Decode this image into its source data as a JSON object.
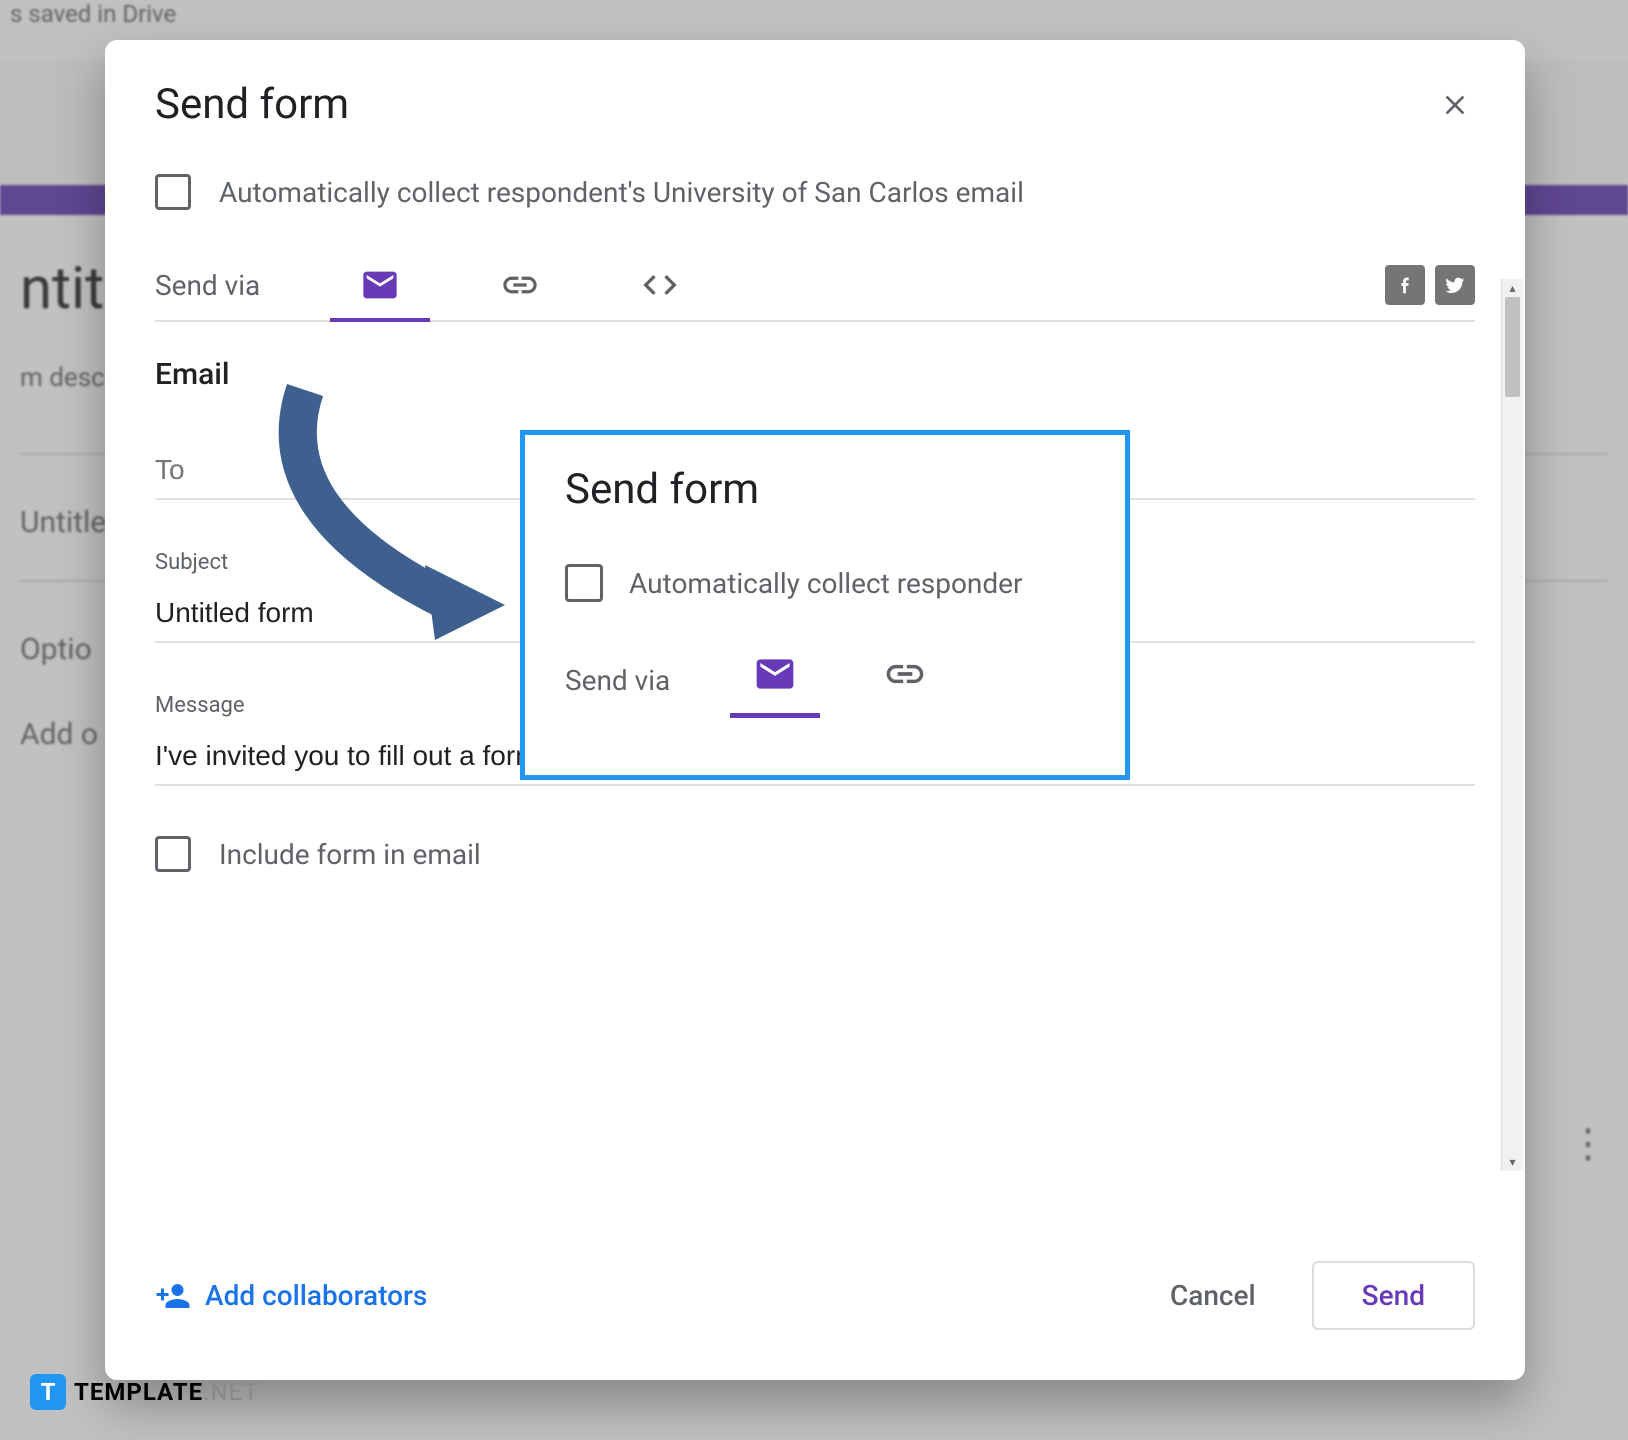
{
  "background": {
    "saved_text": "s saved in Drive",
    "form_title_partial": "ntit",
    "form_desc_partial": "m desc",
    "untitled_partial": "Untitle",
    "option_partial": "Optio",
    "add_partial": "Add o"
  },
  "dialog": {
    "title": "Send form",
    "auto_collect_label": "Automatically collect respondent's University of San Carlos email",
    "send_via_label": "Send via",
    "email_section": "Email",
    "to_label": "To",
    "to_value": "",
    "subject_label": "Subject",
    "subject_value": "Untitled form",
    "message_label": "Message",
    "message_value": "I've invited you to fill out a form:",
    "include_form_label": "Include form in email",
    "add_collaborators_label": "Add collaborators",
    "cancel_label": "Cancel",
    "send_label": "Send"
  },
  "callout": {
    "title": "Send form",
    "auto_collect_partial": "Automatically collect responder",
    "send_via_label": "Send via"
  },
  "watermark": {
    "icon_letter": "T",
    "text_main": "TEMPLATE",
    "text_net": ".NET"
  }
}
